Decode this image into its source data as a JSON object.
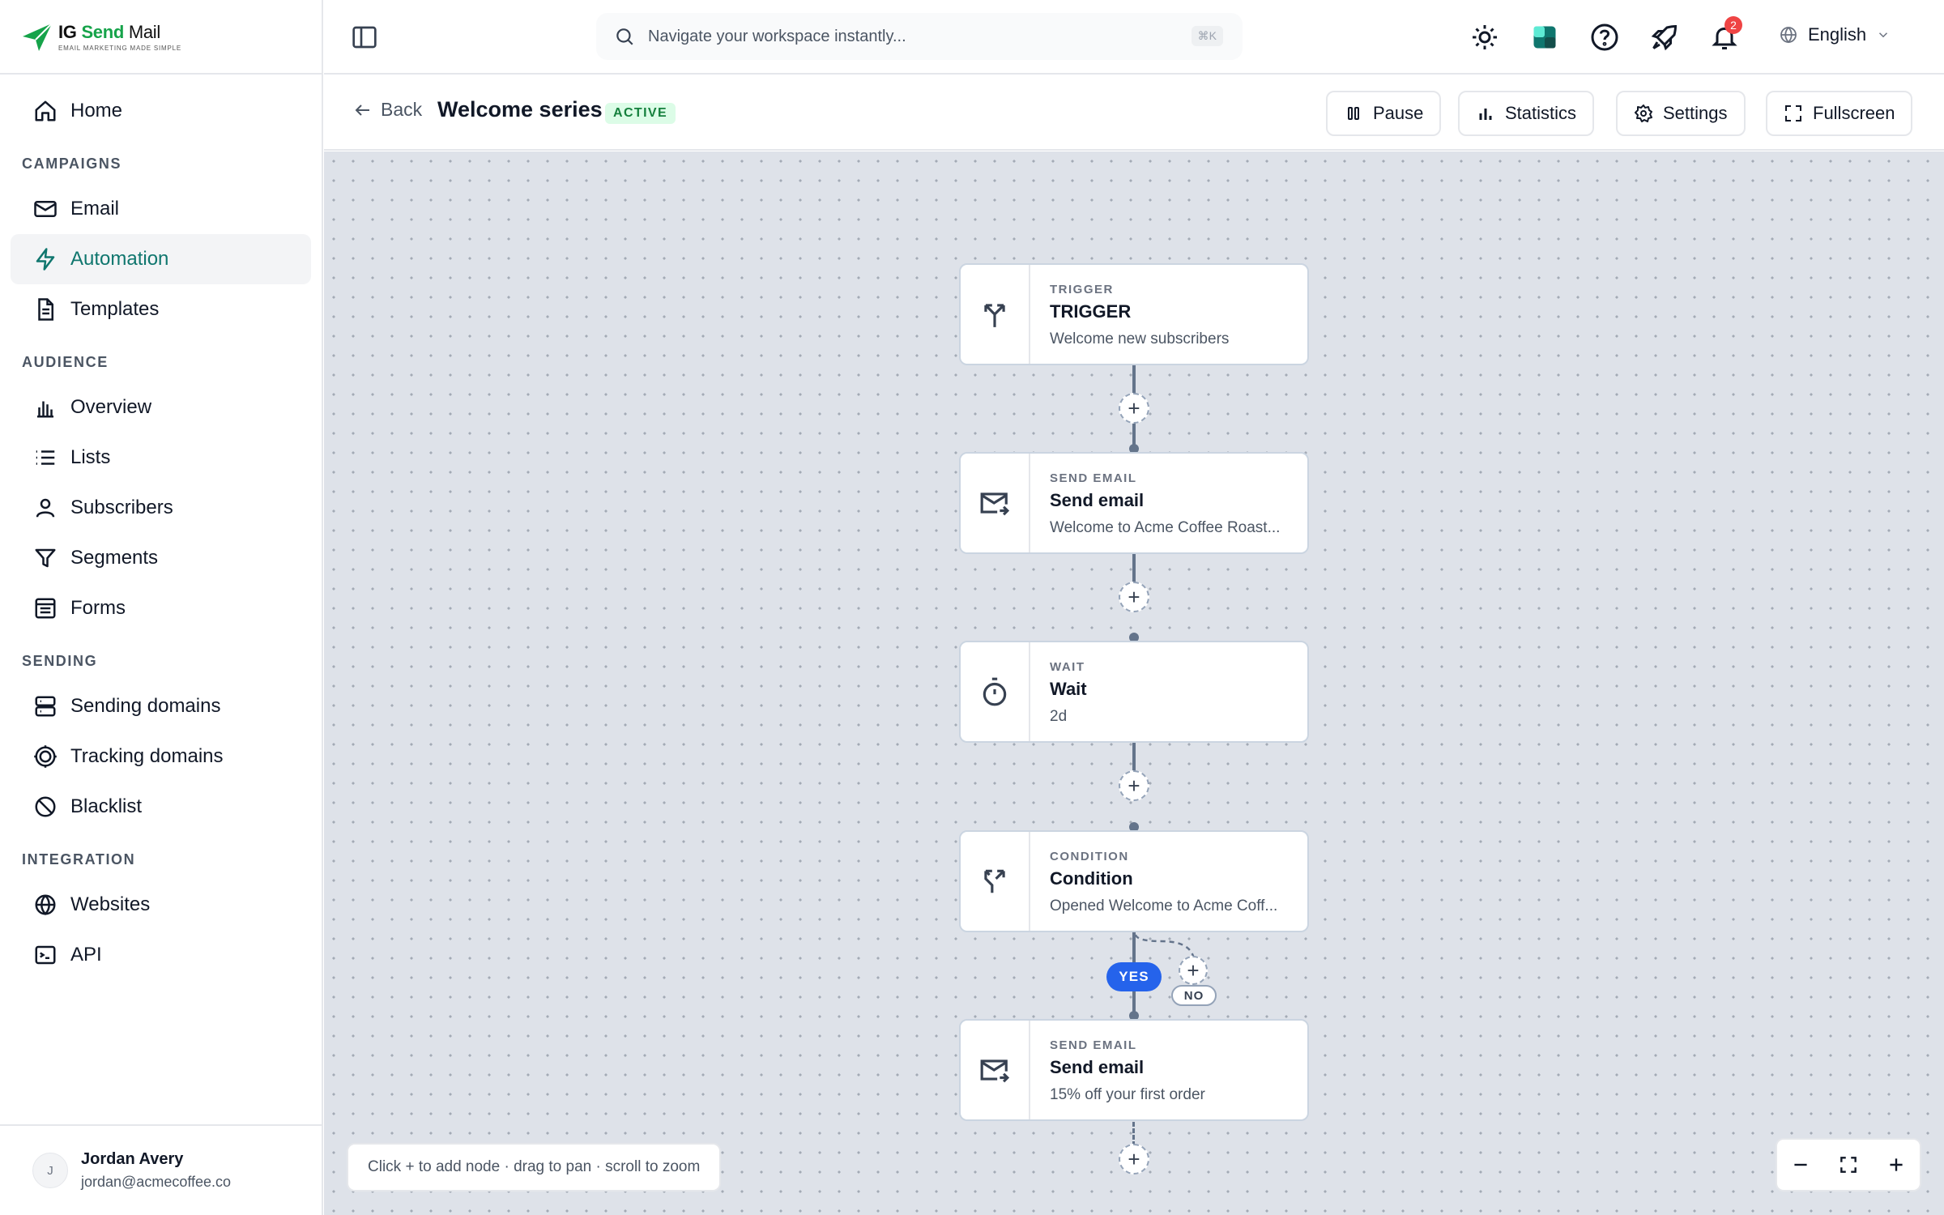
{
  "brand": {
    "name_ig": "IG",
    "name_send": "Send",
    "name_mail": "Mail",
    "tagline": "EMAIL MARKETING MADE SIMPLE",
    "accent": "#16a34a"
  },
  "sidebar": {
    "home": "Home",
    "sections": {
      "campaigns": "CAMPAIGNS",
      "audience": "AUDIENCE",
      "sending": "SENDING",
      "integration": "INTEGRATION"
    },
    "items": {
      "email": "Email",
      "automation": "Automation",
      "templates": "Templates",
      "overview": "Overview",
      "lists": "Lists",
      "subscribers": "Subscribers",
      "segments": "Segments",
      "forms": "Forms",
      "sending_domains": "Sending domains",
      "tracking_domains": "Tracking domains",
      "blacklist": "Blacklist",
      "websites": "Websites",
      "api": "API"
    },
    "active_color": "#0f766e",
    "user": {
      "initial": "J",
      "name": "Jordan Avery",
      "email": "jordan@acmecoffee.co"
    }
  },
  "header": {
    "search_placeholder": "Navigate your workspace instantly...",
    "shortcut": "⌘K",
    "notification_count": "2",
    "language": "English"
  },
  "automation": {
    "back": "Back",
    "title": "Welcome series",
    "status": "ACTIVE",
    "actions": {
      "pause": "Pause",
      "statistics": "Statistics",
      "settings": "Settings",
      "fullscreen": "Fullscreen"
    }
  },
  "flow": {
    "nodes": [
      {
        "type": "TRIGGER",
        "title": "TRIGGER",
        "desc": "Welcome new subscribers",
        "icon": "split-arrows-icon"
      },
      {
        "type": "SEND EMAIL",
        "title": "Send email",
        "desc": "Welcome to Acme Coffee Roast...",
        "icon": "mail-send-icon"
      },
      {
        "type": "WAIT",
        "title": "Wait",
        "desc": "2d",
        "icon": "timer-icon"
      },
      {
        "type": "CONDITION",
        "title": "Condition",
        "desc": "Opened Welcome to Acme Coff...",
        "icon": "branch-icon"
      },
      {
        "type": "SEND EMAIL",
        "title": "Send email",
        "desc": "15% off your first order",
        "icon": "mail-send-icon"
      }
    ],
    "yes_label": "YES",
    "no_label": "NO",
    "add_symbol": "+"
  },
  "canvas": {
    "hint": "Click + to add node · drag to pan · scroll to zoom"
  }
}
